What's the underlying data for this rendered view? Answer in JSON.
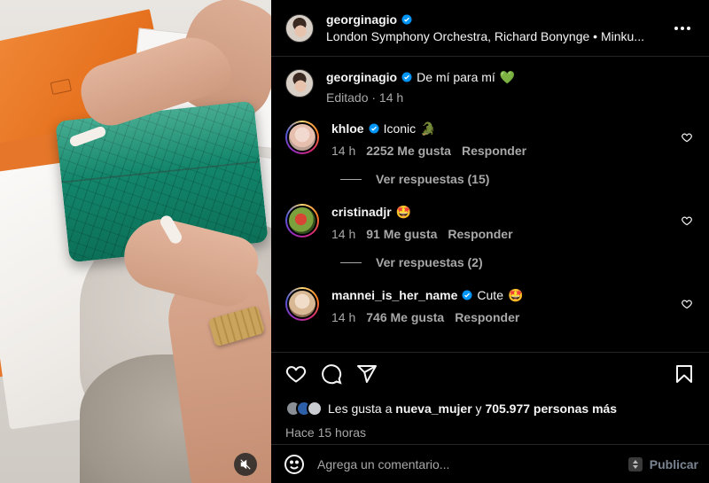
{
  "post": {
    "username": "georginagio",
    "audio": "London Symphony Orchestra, Richard Bonynge • Minku...",
    "caption_user": "georginagio",
    "caption_text": "De mí para mí",
    "caption_emoji": "💚",
    "caption_meta": "Editado · 14 h"
  },
  "comments": [
    {
      "user": "khloe",
      "text": "Iconic",
      "emoji": "🐊",
      "time": "14 h",
      "likes": "2252 Me gusta",
      "reply": "Responder",
      "replies": "Ver respuestas (15)",
      "verified": true
    },
    {
      "user": "cristinadjr",
      "text": "",
      "emoji": "🤩",
      "time": "14 h",
      "likes": "91 Me gusta",
      "reply": "Responder",
      "replies": "Ver respuestas (2)",
      "verified": false
    },
    {
      "user": "mannei_is_her_name",
      "text": "Cute",
      "emoji": "🤩",
      "time": "14 h",
      "likes": "746 Me gusta",
      "reply": "Responder",
      "verified": true
    }
  ],
  "likes": {
    "prefix": "Les gusta a",
    "user": "nueva_mujer",
    "conj": "y",
    "others": "705.977 personas más"
  },
  "posted": "Hace 15 horas",
  "composer": {
    "placeholder": "Agrega un comentario...",
    "post_label": "Publicar"
  },
  "icons": {
    "more": "more-horizontal-icon",
    "like": "heart-icon",
    "comment": "comment-icon",
    "share": "send-icon",
    "save": "bookmark-icon",
    "emoji": "emoji-icon",
    "mute": "muted-speaker-icon"
  },
  "colors": {
    "background": "#000000",
    "text": "#f5f5f5",
    "muted": "#a8a8a8",
    "verified": "#0095f6",
    "divider": "#262626"
  }
}
